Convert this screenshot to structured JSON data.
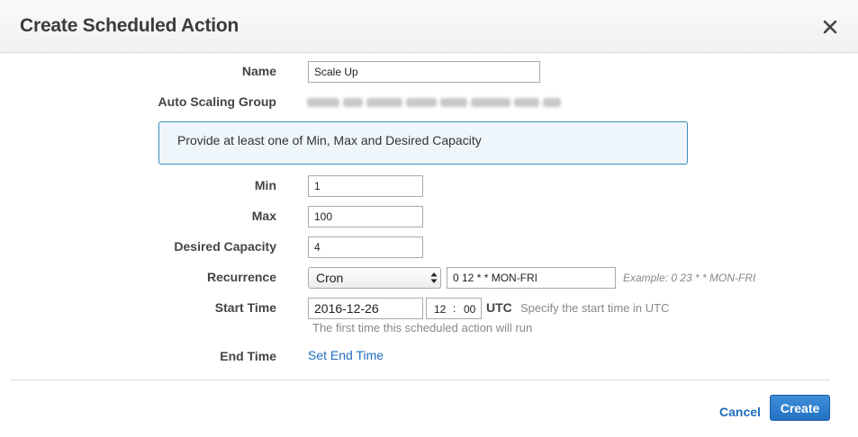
{
  "dialog": {
    "title": "Create Scheduled Action"
  },
  "form": {
    "name_label": "Name",
    "name_value": "Scale Up",
    "asg_label": "Auto Scaling Group",
    "info_text": "Provide at least one of Min, Max and Desired Capacity",
    "min_label": "Min",
    "min_value": "1",
    "max_label": "Max",
    "max_value": "100",
    "desired_label": "Desired Capacity",
    "desired_value": "4",
    "recurrence_label": "Recurrence",
    "recurrence_selected": "Cron",
    "cron_value": "0 12 * * MON-FRI",
    "cron_example": "Example: 0 23 * * MON-FRI",
    "start_label": "Start Time",
    "start_date": "2016-12-26",
    "start_hour": "12",
    "start_sep": ":",
    "start_minute": "00",
    "utc_label": "UTC",
    "utc_hint": "Specify the start time in UTC",
    "first_run_hint": "The first time this scheduled action will run",
    "end_label": "End Time",
    "end_link": "Set End Time"
  },
  "footer": {
    "cancel_label": "Cancel",
    "create_label": "Create"
  },
  "colors": {
    "accent": "#2273c5",
    "link": "#1f6dc0",
    "info_border": "#3a8dbb",
    "info_bg": "#eef6fb"
  },
  "icons": {
    "close": "close-icon",
    "select_arrows": "updown-arrows-icon"
  }
}
